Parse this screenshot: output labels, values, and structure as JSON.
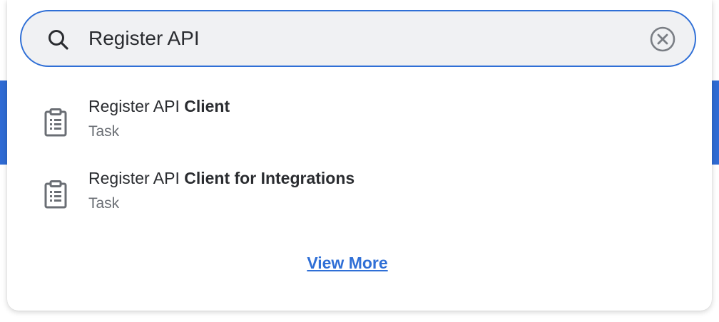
{
  "search": {
    "value": "Register API",
    "icon": "search-icon",
    "clear_icon": "clear-icon"
  },
  "results": [
    {
      "title_plain": "Register API ",
      "title_bold": "Client",
      "type": "Task",
      "icon": "clipboard-icon"
    },
    {
      "title_plain": "Register API ",
      "title_bold": "Client for Integrations",
      "type": "Task",
      "icon": "clipboard-icon"
    }
  ],
  "view_more_label": "View More",
  "colors": {
    "accent": "#2f6fd6",
    "band": "#2f6bd4",
    "text": "#2a2c30",
    "muted": "#6a6e74"
  }
}
